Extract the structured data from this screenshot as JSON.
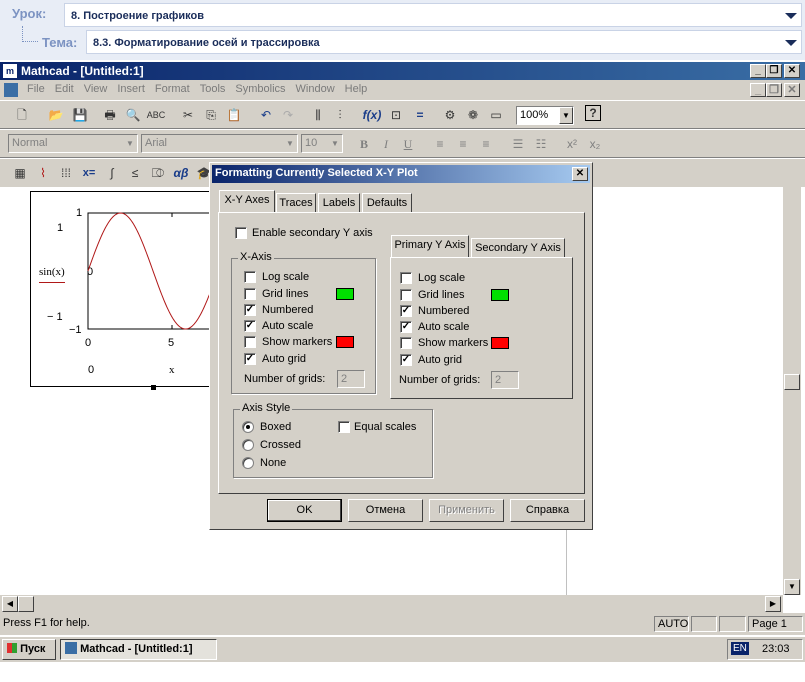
{
  "lesson": {
    "lesson_label": "Урок:",
    "lesson_title": "8. Построение графиков",
    "topic_label": "Тема:",
    "topic_title": "8.3. Форматирование осей и трассировка"
  },
  "app": {
    "title": "Mathcad - [Untitled:1]",
    "minimize": "_",
    "restore": "❐",
    "close": "✕"
  },
  "menu": [
    "File",
    "Edit",
    "View",
    "Insert",
    "Format",
    "Tools",
    "Symbolics",
    "Window",
    "Help"
  ],
  "toolbar": {
    "zoom": "100%",
    "style": "Normal",
    "font": "Arial",
    "size": "10"
  },
  "plot": {
    "ylabel": "sin(x)",
    "ytick_top": "1",
    "ytick_bottom": "−1",
    "xtick_left": "0",
    "xtick_mid": "5",
    "xlabel": "x",
    "ymax_marker": "1",
    "ymin_marker": "− 1",
    "xmin_marker": "0"
  },
  "chart_data": {
    "type": "line",
    "series": [
      {
        "name": "sin(x)",
        "color": "#b01818"
      }
    ],
    "xlim": [
      0,
      6.28
    ],
    "ylim": [
      -1,
      1
    ],
    "xlabel": "x",
    "ylabel": "sin(x)"
  },
  "dialog": {
    "title": "Formatting Currently Selected X-Y Plot",
    "tabs": [
      "X-Y Axes",
      "Traces",
      "Labels",
      "Defaults"
    ],
    "enable_secondary": "Enable secondary Y axis",
    "xaxis_group": "X-Axis",
    "yaxis_tabs": [
      "Primary Y Axis",
      "Secondary Y Axis"
    ],
    "options": [
      {
        "label": "Log scale",
        "x": false,
        "y": false
      },
      {
        "label": "Grid lines",
        "x": false,
        "y": false
      },
      {
        "label": "Numbered",
        "x": true,
        "y": true
      },
      {
        "label": "Auto scale",
        "x": true,
        "y": true
      },
      {
        "label": "Show markers",
        "x": false,
        "y": false
      },
      {
        "label": "Auto grid",
        "x": true,
        "y": true
      }
    ],
    "grid_color": "#00e000",
    "marker_color": "#ff0000",
    "num_grids_label": "Number of grids:",
    "num_grids_x": "2",
    "num_grids_y": "2",
    "axis_style_group": "Axis Style",
    "styles": [
      "Boxed",
      "Crossed",
      "None"
    ],
    "selected_style": "Boxed",
    "equal_scales": "Equal scales",
    "buttons": {
      "ok": "OK",
      "cancel": "Отмена",
      "apply": "Применить",
      "help": "Справка"
    }
  },
  "status": {
    "help": "Press F1 for help.",
    "auto": "AUTO",
    "page": "Page 1"
  },
  "taskbar": {
    "start": "Пуск",
    "task": "Mathcad - [Untitled:1]",
    "lang": "EN",
    "time": "23:03"
  }
}
